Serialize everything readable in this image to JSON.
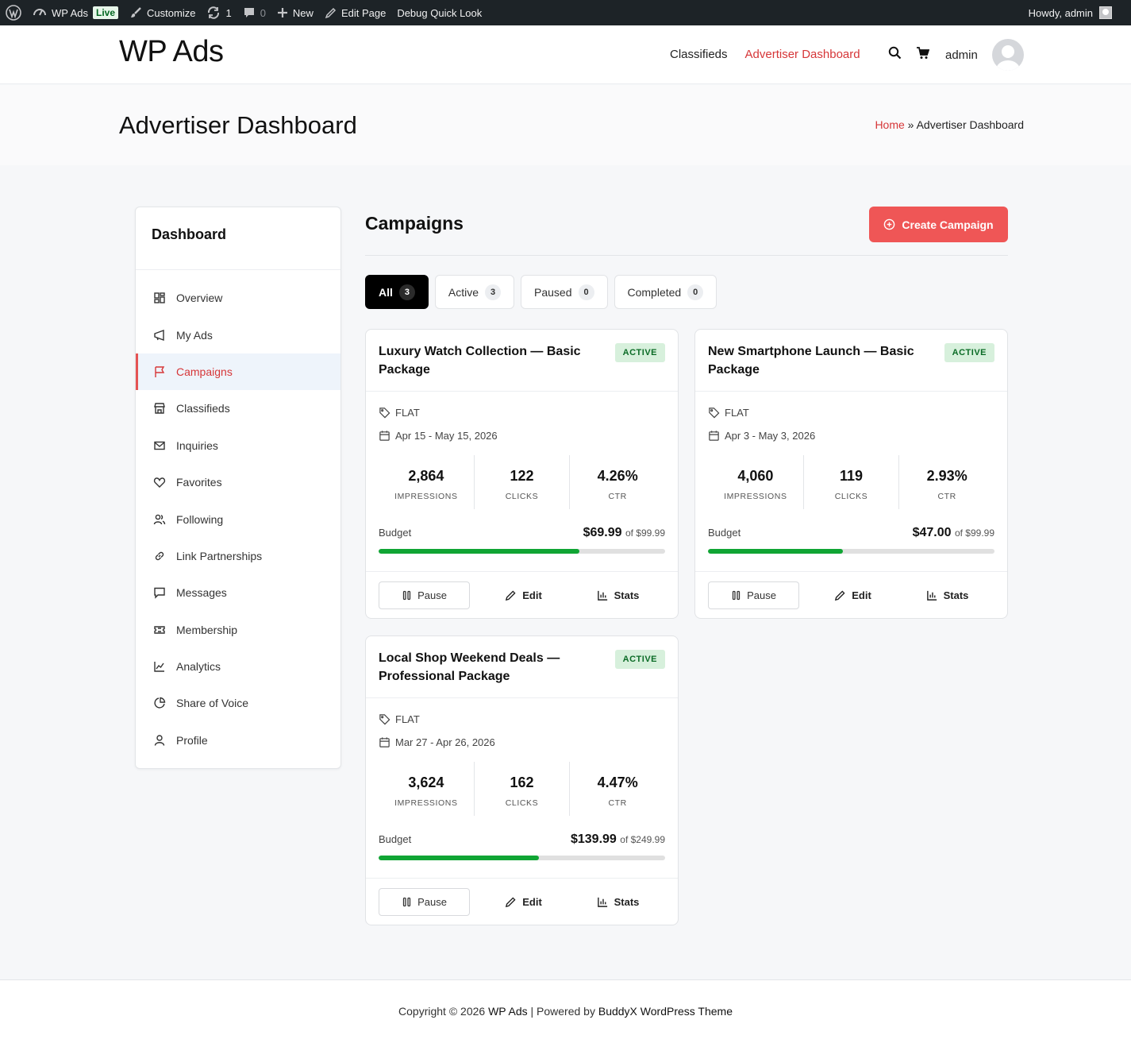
{
  "admin_bar": {
    "site_name": "WP Ads",
    "live_badge": "Live",
    "customize": "Customize",
    "updates_count": "1",
    "comments_count": "0",
    "new": "New",
    "edit_page": "Edit Page",
    "debug": "Debug Quick Look",
    "howdy": "Howdy, admin"
  },
  "header": {
    "site_title": "WP Ads",
    "nav": [
      "Classifieds",
      "Advertiser Dashboard"
    ],
    "user": "admin"
  },
  "page": {
    "title": "Advertiser Dashboard",
    "breadcrumb_home": "Home",
    "breadcrumb_sep": " » ",
    "breadcrumb_current": "Advertiser Dashboard"
  },
  "sidebar": {
    "title": "Dashboard",
    "items": [
      {
        "label": "Overview",
        "icon": "grid-icon"
      },
      {
        "label": "My Ads",
        "icon": "megaphone-icon"
      },
      {
        "label": "Campaigns",
        "icon": "flag-icon",
        "active": true
      },
      {
        "label": "Classifieds",
        "icon": "store-icon"
      },
      {
        "label": "Inquiries",
        "icon": "mail-icon"
      },
      {
        "label": "Favorites",
        "icon": "heart-icon"
      },
      {
        "label": "Following",
        "icon": "users-icon"
      },
      {
        "label": "Link Partnerships",
        "icon": "link-icon"
      },
      {
        "label": "Messages",
        "icon": "message-icon"
      },
      {
        "label": "Membership",
        "icon": "ticket-icon"
      },
      {
        "label": "Analytics",
        "icon": "chart-icon"
      },
      {
        "label": "Share of Voice",
        "icon": "pie-icon"
      },
      {
        "label": "Profile",
        "icon": "user-icon"
      }
    ]
  },
  "main": {
    "title": "Campaigns",
    "create_button": "Create Campaign",
    "tabs": [
      {
        "label": "All",
        "count": "3"
      },
      {
        "label": "Active",
        "count": "3"
      },
      {
        "label": "Paused",
        "count": "0"
      },
      {
        "label": "Completed",
        "count": "0"
      }
    ],
    "impressions_label": "IMPRESSIONS",
    "clicks_label": "CLICKS",
    "ctr_label": "CTR",
    "budget_label": "Budget",
    "pause_label": "Pause",
    "edit_label": "Edit",
    "stats_label": "Stats",
    "campaigns": [
      {
        "title": "Luxury Watch Collection — Basic Package",
        "status": "ACTIVE",
        "pricing": "FLAT",
        "dates": "Apr 15 - May 15, 2026",
        "impressions": "2,864",
        "clicks": "122",
        "ctr": "4.26%",
        "spent": "$69.99",
        "of_budget": "of $99.99",
        "progress": 0.7
      },
      {
        "title": "New Smartphone Launch — Basic Package",
        "status": "ACTIVE",
        "pricing": "FLAT",
        "dates": "Apr 3 - May 3, 2026",
        "impressions": "4,060",
        "clicks": "119",
        "ctr": "2.93%",
        "spent": "$47.00",
        "of_budget": "of $99.99",
        "progress": 0.47
      },
      {
        "title": "Local Shop Weekend Deals — Professional Package",
        "status": "ACTIVE",
        "pricing": "FLAT",
        "dates": "Mar 27 - Apr 26, 2026",
        "impressions": "3,624",
        "clicks": "162",
        "ctr": "4.47%",
        "spent": "$139.99",
        "of_budget": "of $249.99",
        "progress": 0.56
      }
    ]
  },
  "footer": {
    "prefix": "Copyright © 2026 ",
    "site": "WP Ads",
    "middle": " | Powered by ",
    "theme": "BuddyX WordPress Theme"
  },
  "colors": {
    "accent": "#ef5656",
    "link_red": "#d63638",
    "progress_green": "#10a534",
    "badge_bg": "#d7f0dc"
  }
}
